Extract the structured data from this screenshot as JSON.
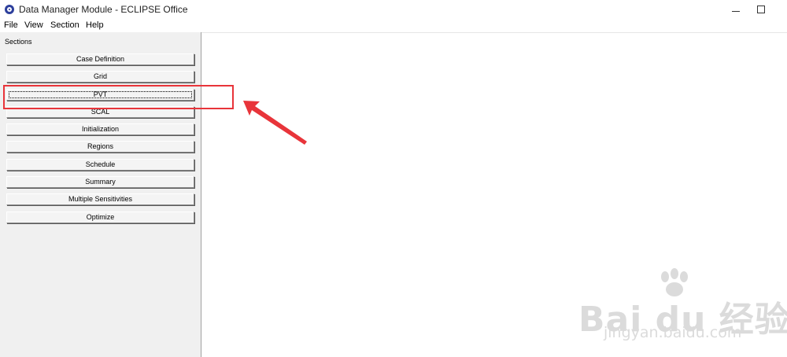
{
  "window": {
    "title": "Data Manager Module - ECLIPSE Office",
    "minimize_glyph": "—",
    "maximize_glyph": "☐"
  },
  "menu": {
    "items": [
      "File",
      "View",
      "Section",
      "Help"
    ]
  },
  "sections_panel": {
    "title": "Sections",
    "buttons": [
      "Case Definition",
      "Grid",
      "PVT",
      "SCAL",
      "Initialization",
      "Regions",
      "Schedule",
      "Summary",
      "Multiple Sensitivities",
      "Optimize"
    ],
    "focused_button": "PVT"
  },
  "annotation": {
    "highlight_color": "#e8343a"
  },
  "watermark": {
    "brand": "Bai du 经验",
    "url": "jingyan.baidu.com"
  },
  "icons": [
    "eclipse-app-icon",
    "minimize-icon",
    "maximize-icon",
    "arrow-annotation",
    "baidu-paw-logo"
  ]
}
